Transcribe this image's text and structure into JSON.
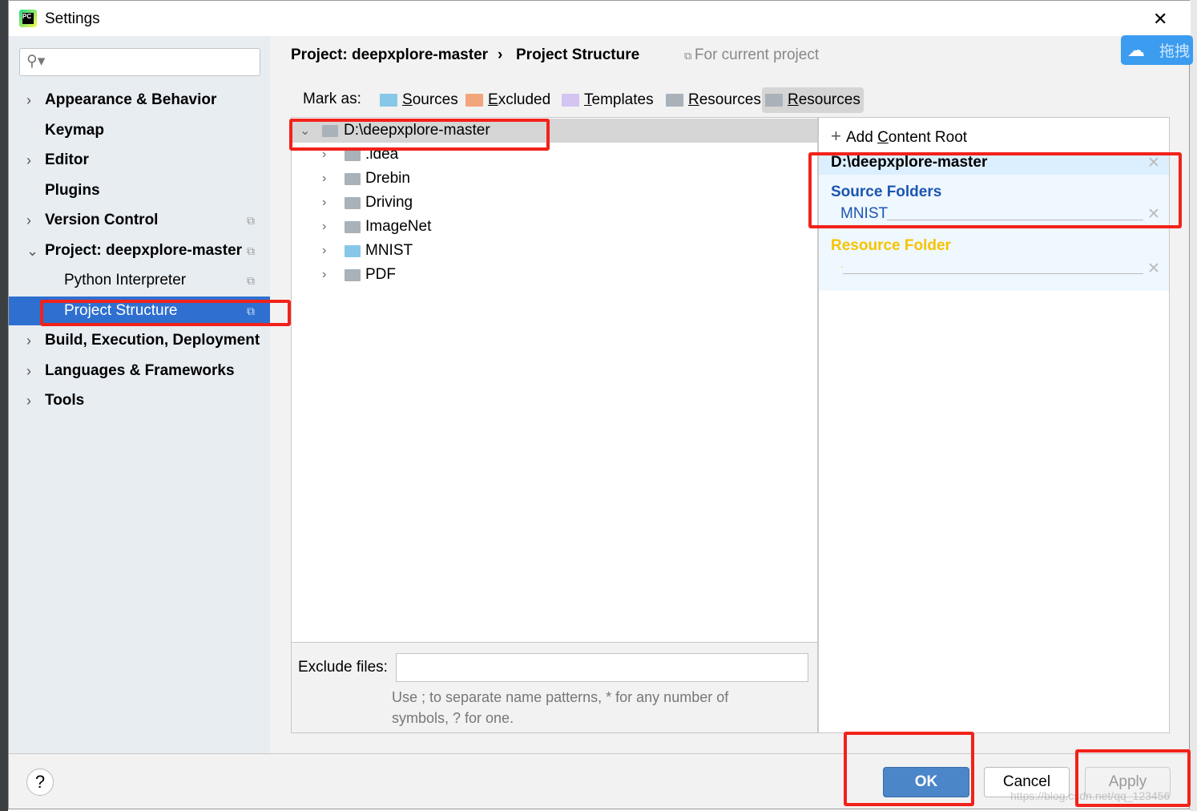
{
  "window": {
    "title": "Settings",
    "close": "✕"
  },
  "search": {
    "placeholder": "",
    "icon": "search-icon"
  },
  "sidebar": {
    "items": [
      {
        "label": "Appearance & Behavior",
        "chevron": "›"
      },
      {
        "label": "Keymap",
        "chevron": ""
      },
      {
        "label": "Editor",
        "chevron": "›"
      },
      {
        "label": "Plugins",
        "chevron": ""
      },
      {
        "label": "Version Control",
        "chevron": "›",
        "copy": "⧉"
      },
      {
        "label": "Project: deepxplore-master",
        "chevron": "⌄",
        "copy": "⧉"
      },
      {
        "label": "Python Interpreter",
        "copy": "⧉"
      },
      {
        "label": "Project Structure",
        "copy": "⧉",
        "selected": true
      },
      {
        "label": "Build, Execution, Deployment",
        "chevron": "›"
      },
      {
        "label": "Languages & Frameworks",
        "chevron": "›"
      },
      {
        "label": "Tools",
        "chevron": "›"
      }
    ]
  },
  "breadcrumb": {
    "project": "Project: deepxplore-master",
    "sep": "›",
    "page": "Project Structure",
    "scope": "For current project"
  },
  "cloud": {
    "label": "拖拽"
  },
  "mark_as": {
    "label": "Mark as:",
    "buttons": [
      {
        "label": "Sources",
        "key": "S",
        "rest": "ources",
        "color": "#87c8e8"
      },
      {
        "label": "Excluded",
        "key": "E",
        "rest": "xcluded",
        "color": "#f2a57a"
      },
      {
        "label": "Templates",
        "key": "T",
        "rest": "emplates",
        "color": "#d3c4f2"
      },
      {
        "label": "Resources",
        "key": "R",
        "rest": "esources",
        "color": "#a9b1b9"
      },
      {
        "label": "Resources",
        "key": "R",
        "rest": "esources",
        "color": "#a9b1b9"
      }
    ]
  },
  "tree": {
    "root": "D:\\deepxplore-master",
    "children": [
      {
        "name": ".idea",
        "color": "#a9b1b9"
      },
      {
        "name": "Drebin",
        "color": "#a9b1b9"
      },
      {
        "name": "Driving",
        "color": "#a9b1b9"
      },
      {
        "name": "ImageNet",
        "color": "#a9b1b9"
      },
      {
        "name": "MNIST",
        "color": "#87c8e8"
      },
      {
        "name": "PDF",
        "color": "#a9b1b9"
      }
    ]
  },
  "content_root": {
    "add_label_pre": "Add ",
    "add_key": "C",
    "add_rest": "ontent Root",
    "root": "D:\\deepxplore-master",
    "source_title": "Source Folders",
    "source_item": "MNIST",
    "resource_title": "Resource Folder",
    "resource_item": ".",
    "source_color": "#1a56b0",
    "resource_color": "#f5c400"
  },
  "exclude": {
    "label": "Exclude files:",
    "value": "",
    "hint": "Use ; to separate name patterns, * for any number of symbols, ? for one."
  },
  "footer": {
    "help": "?",
    "ok": "OK",
    "cancel": "Cancel",
    "apply": "Apply",
    "watermark": "https://blog.csdn.net/qq_123456"
  }
}
